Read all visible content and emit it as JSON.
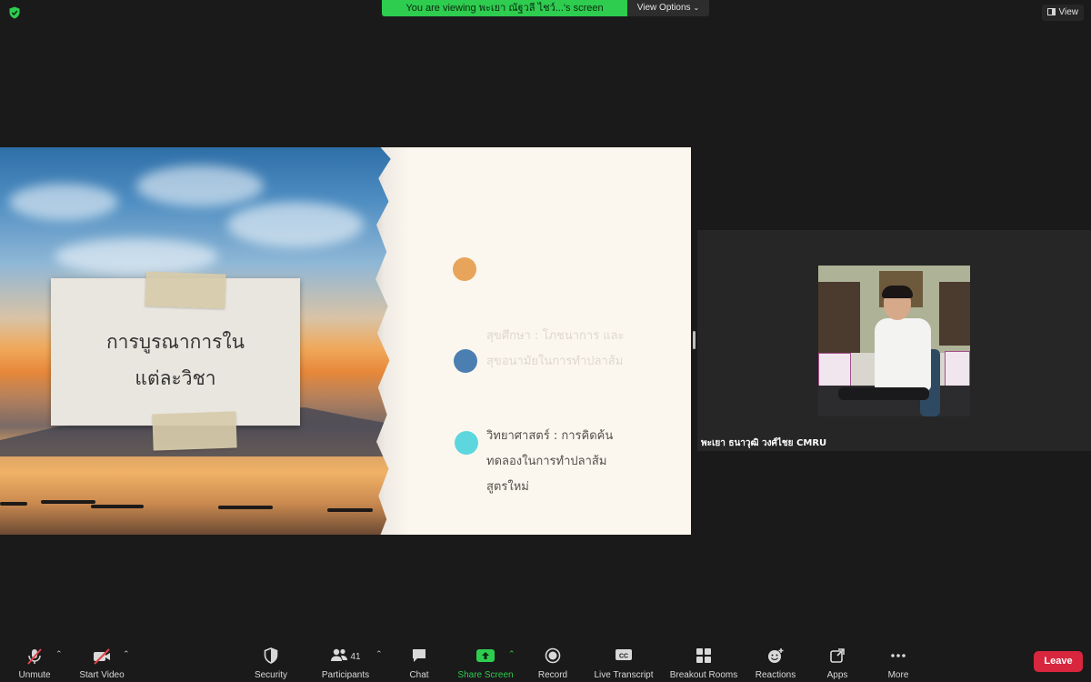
{
  "top_bar": {
    "viewing_banner": "You are viewing พะเยา ณัฐวลี ไชว์...'s screen",
    "view_options_label": "View Options",
    "view_button_label": "View"
  },
  "shared_slide": {
    "card_title": "การบูรณาการใน\nแต่ละวิชา",
    "bullets": [
      {
        "text": "",
        "color": "#e8a45a"
      },
      {
        "text": "สุขศึกษา : โภชนาการ และ\nสุขอนามัยในการทำปลาส้ม",
        "color": "#4b7fb2"
      },
      {
        "text": "วิทยาศาสตร์ : การคิดค้น\nทดลองในการทำปลาส้ม\nสูตรใหม่",
        "color": "#5ed6de"
      }
    ]
  },
  "participant": {
    "name": "พะเยา ธนาวุฒิ วงศ์ไชย CMRU"
  },
  "toolbar": {
    "unmute": "Unmute",
    "start_video": "Start Video",
    "security": "Security",
    "participants": "Participants",
    "participants_count": "41",
    "chat": "Chat",
    "share_screen": "Share Screen",
    "record": "Record",
    "live_transcript": "Live Transcript",
    "breakout_rooms": "Breakout Rooms",
    "reactions": "Reactions",
    "apps": "Apps",
    "more": "More",
    "leave": "Leave"
  },
  "colors": {
    "banner_green": "#2ecc4f",
    "leave_red": "#d7263d",
    "background": "#1a1a1a"
  }
}
